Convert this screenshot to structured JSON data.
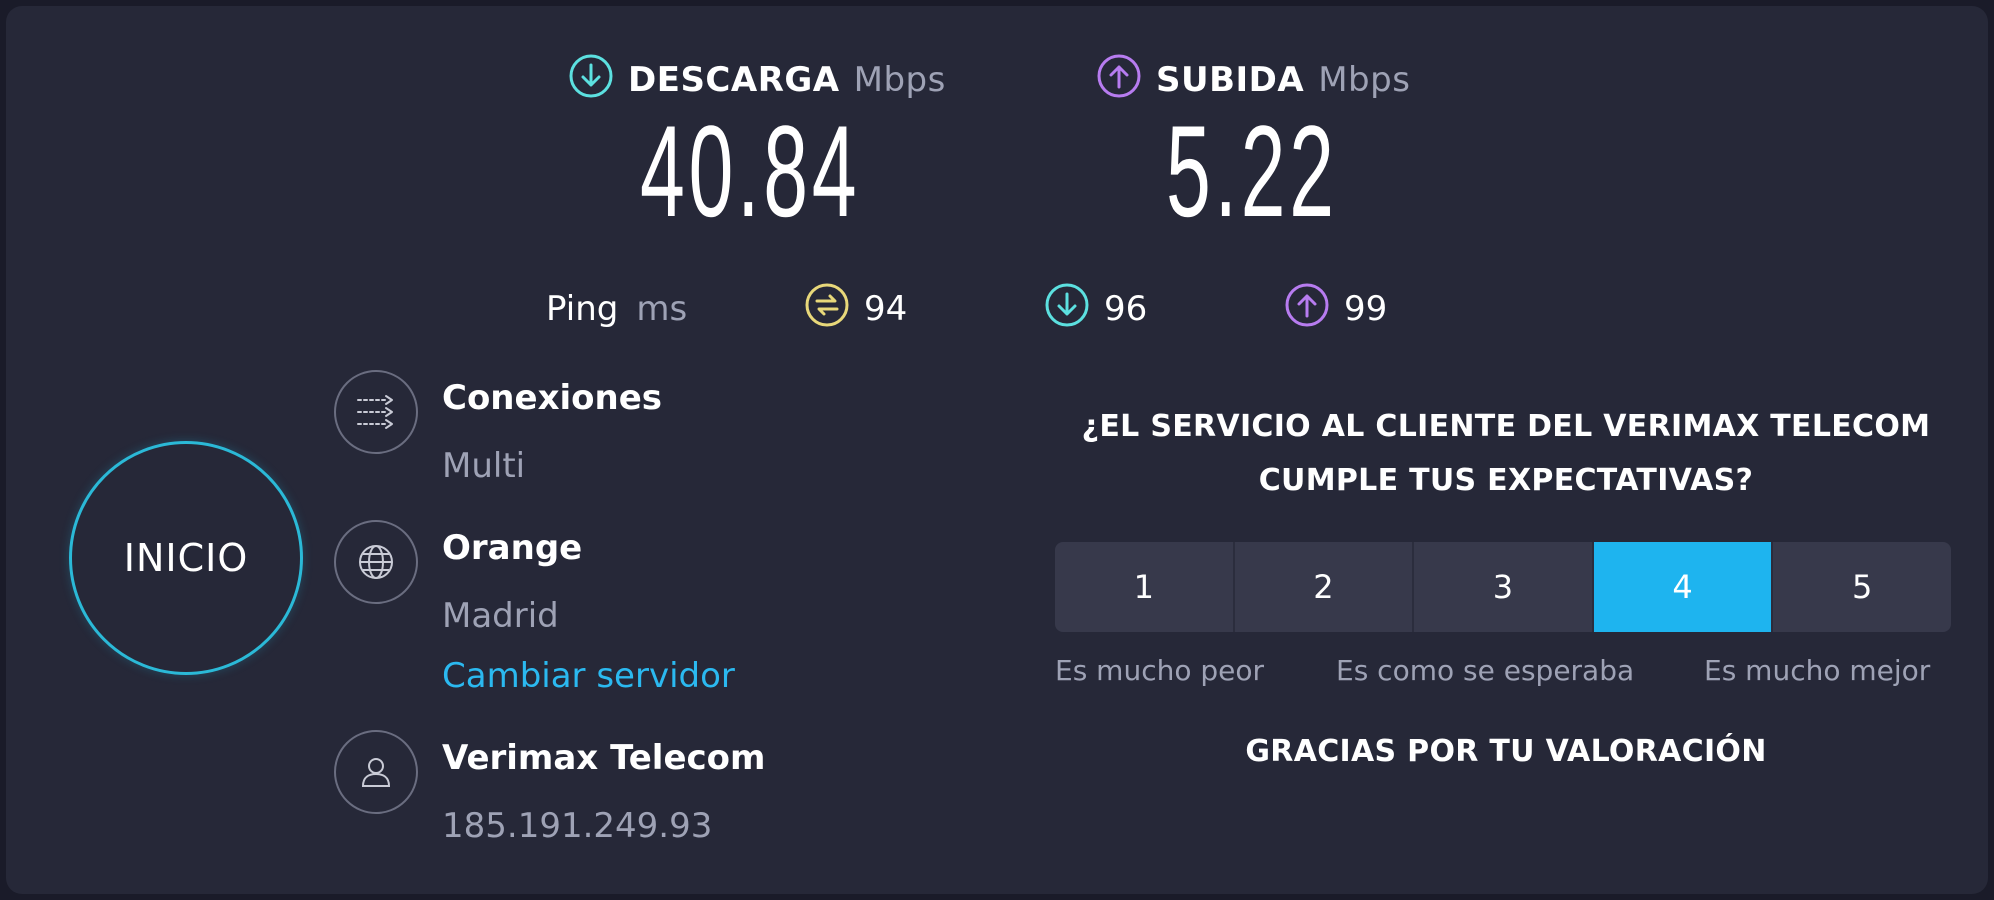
{
  "download": {
    "label": "DESCARGA",
    "unit": "Mbps",
    "value": "40.84",
    "icon": "download-arrow-icon",
    "color": "#5ce0e0"
  },
  "upload": {
    "label": "SUBIDA",
    "unit": "Mbps",
    "value": "5.22",
    "icon": "upload-arrow-icon",
    "color": "#b77cf0"
  },
  "ping": {
    "label": "Ping",
    "unit": "ms",
    "idle": "94",
    "download": "96",
    "upload": "99",
    "idle_color": "#e8d87a",
    "download_color": "#5ce0e0",
    "upload_color": "#b77cf0"
  },
  "start_button": {
    "label": "INICIO",
    "color": "#2bb9d7"
  },
  "connections": {
    "title": "Conexiones",
    "value": "Multi",
    "icon": "connections-icon"
  },
  "server": {
    "title": "Orange",
    "location": "Madrid",
    "change_link": "Cambiar servidor",
    "icon": "globe-icon"
  },
  "provider": {
    "title": "Verimax Telecom",
    "ip": "185.191.249.93",
    "icon": "user-icon"
  },
  "survey": {
    "question_line1": "¿EL SERVICIO AL CLIENTE DEL VERIMAX TELECOM",
    "question_line2": "CUMPLE TUS EXPECTATIVAS?",
    "options": [
      "1",
      "2",
      "3",
      "4",
      "5"
    ],
    "selected": "4",
    "label_low": "Es mucho peor",
    "label_mid": "Es como se esperaba",
    "label_high": "Es mucho mejor",
    "thanks": "GRACIAS POR TU VALORACIÓN",
    "accent": "#1eb4ef"
  }
}
